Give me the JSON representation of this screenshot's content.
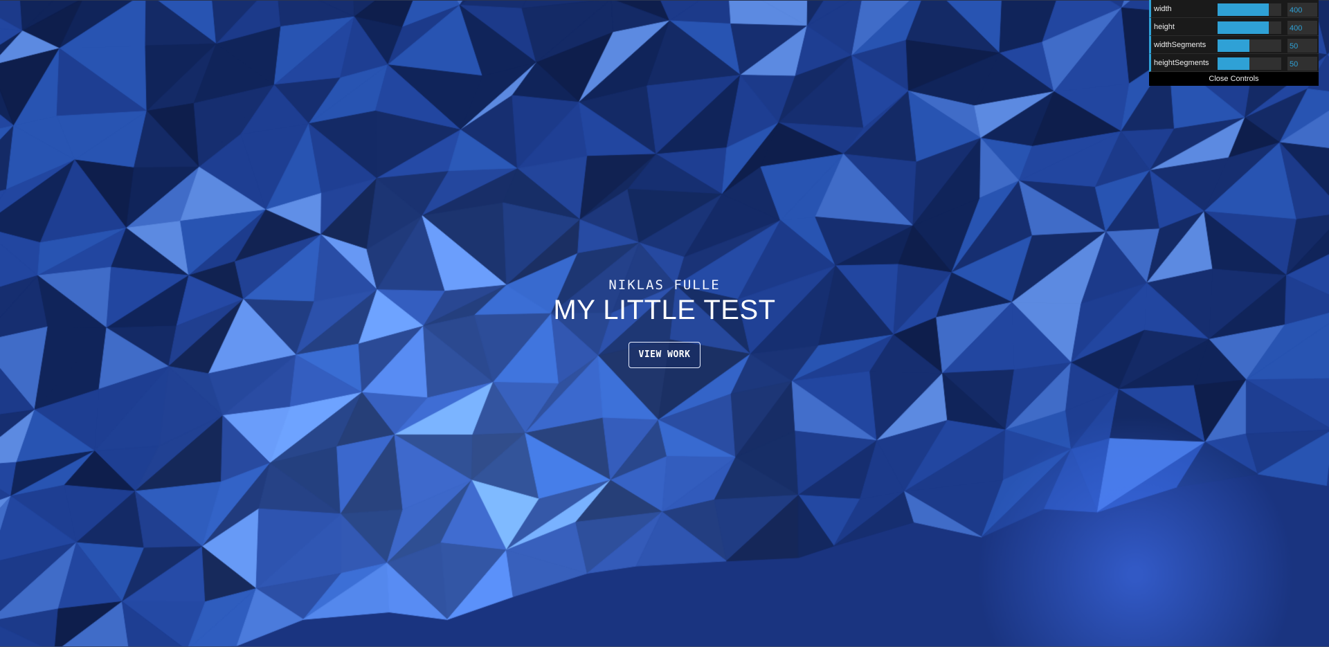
{
  "hero": {
    "subtitle": "NIKLAS FULLE",
    "title": "MY LITTLE TEST",
    "button_label": "VIEW WORK"
  },
  "controls": {
    "items": [
      {
        "label": "width",
        "value": "400",
        "fraction": 0.8
      },
      {
        "label": "height",
        "value": "400",
        "fraction": 0.8
      },
      {
        "label": "widthSegments",
        "value": "50",
        "fraction": 0.5
      },
      {
        "label": "heightSegments",
        "value": "50",
        "fraction": 0.5
      }
    ],
    "close_label": "Close Controls"
  },
  "colors": {
    "background_base": "#1a3480",
    "accent": "#2fa1d6",
    "panel_bg": "#1a1a1a",
    "light_highlight": "#6f9ae8",
    "spot_light": "#3a6cf5"
  }
}
